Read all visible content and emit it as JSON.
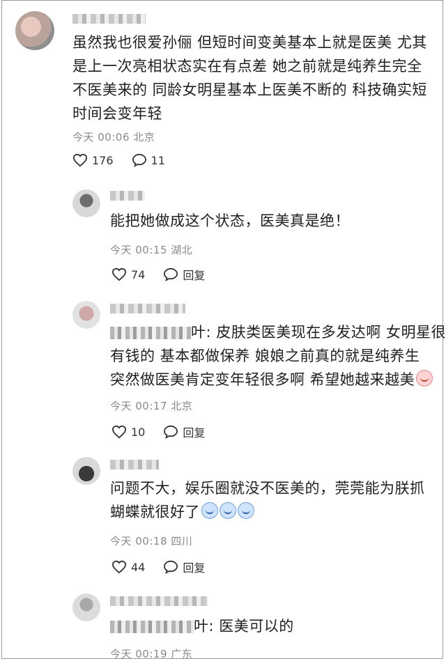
{
  "comments": [
    {
      "text_lines": [
        "虽然我也很爱孙俪 但短时间变美基本上就是医美 尤其",
        "是上一次亮相状态实在有点差 她之前就是纯养生完全",
        "不医美来的 同龄女明星基本上医美不断的 科技确实短",
        "时间会变年轻"
      ],
      "meta": "今天 00:06 北京",
      "likes": "176",
      "replies": "11"
    }
  ],
  "replies": [
    {
      "text_lines": [
        "能把她做成这个状态，医美真是绝！"
      ],
      "meta": "今天 00:15 湖北",
      "likes": "74",
      "reply_label": "回复"
    },
    {
      "prefix_visible": "叶: ",
      "text_lines": [
        "皮肤类医美现在多发达啊 女明星很",
        "有钱的 基本都做保养 娘娘之前真的就是纯养生",
        "突然做医美肯定变年轻很多啊 希望她越来越美"
      ],
      "meta": "今天 00:17 北京",
      "likes": "10",
      "reply_label": "回复"
    },
    {
      "text_lines": [
        "问题不大，娱乐圈就没不医美的，莞莞能为朕抓",
        "蝴蝶就很好了"
      ],
      "meta": "今天 00:18 四川",
      "likes": "44",
      "reply_label": "回复"
    },
    {
      "prefix_visible": "叶: ",
      "text_lines": [
        "医美可以的"
      ],
      "meta": "今天 00:19 广东"
    }
  ],
  "icons": {
    "like": "heart-outline-icon",
    "comment": "speech-bubble-icon"
  }
}
